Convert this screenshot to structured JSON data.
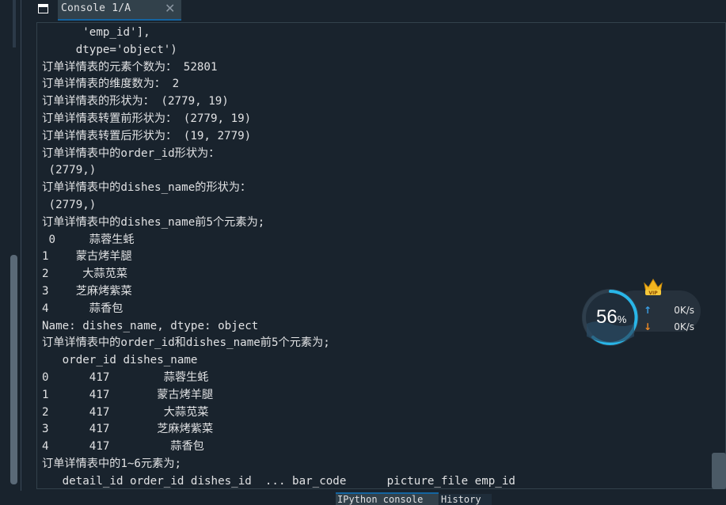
{
  "tab": {
    "title": "Console 1/A"
  },
  "console_lines": [
    "      'emp_id'],",
    "     dtype='object')",
    "订单详情表的元素个数为： 52801",
    "订单详情表的维度数为： 2",
    "订单详情表的形状为： (2779, 19)",
    "订单详情表转置前形状为： (2779, 19)",
    "订单详情表转置后形状为： (19, 2779)",
    "订单详情表中的order_id形状为：",
    " (2779,)",
    "订单详情表中的dishes_name的形状为：",
    " (2779,)",
    "订单详情表中的dishes_name前5个元素为;",
    " 0     蒜蓉生蚝",
    "1    蒙古烤羊腿",
    "2     大蒜苋菜",
    "3    芝麻烤紫菜",
    "4      蒜香包",
    "Name: dishes_name, dtype: object",
    "订单详情表中的order_id和dishes_name前5个元素为;",
    "   order_id dishes_name",
    "0      417        蒜蓉生蚝",
    "1      417       蒙古烤羊腿",
    "2      417        大蒜苋菜",
    "3      417       芝麻烤紫菜",
    "4      417         蒜香包",
    "订单详情表中的1~6元素为;",
    "   detail_id order_id dishes_id  ... bar_code      picture_file emp_id"
  ],
  "bottom_tabs": [
    {
      "label": "IPython console"
    },
    {
      "label": "History"
    }
  ],
  "net_monitor": {
    "percent": "56",
    "percent_sign": "%",
    "upload": "0K/s",
    "download": "0K/s",
    "badge": "VIP",
    "up_icon": "arrow-up-icon",
    "down_icon": "arrow-down-icon"
  },
  "colors": {
    "background": "#19232d",
    "text": "#e0e1e3",
    "tab_active": "#32414b",
    "accent": "#1464a0",
    "ring": "#29b6e8"
  }
}
